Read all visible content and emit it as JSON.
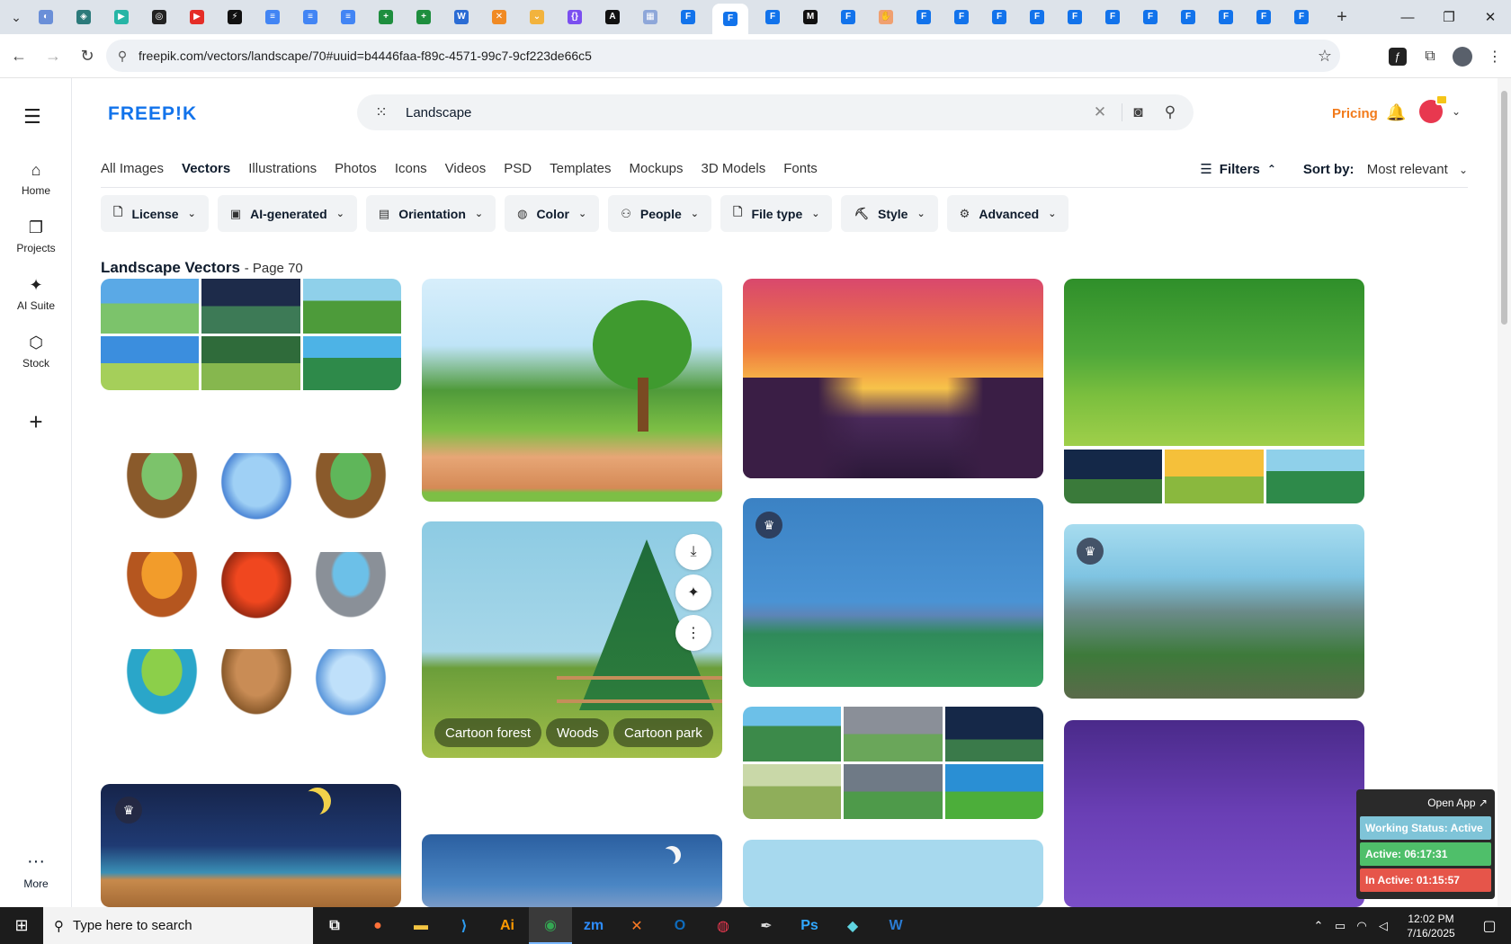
{
  "browser": {
    "tabs": [
      {
        "name": "tab-1",
        "color": "#6a8fd8",
        "glyph": "◐"
      },
      {
        "name": "tab-2",
        "color": "#2c7a7b",
        "glyph": "◈"
      },
      {
        "name": "tab-3",
        "color": "#26b5a6",
        "glyph": "▶"
      },
      {
        "name": "tab-4",
        "color": "#222222",
        "glyph": "◎"
      },
      {
        "name": "tab-youtube",
        "color": "#e52d27",
        "glyph": "▶"
      },
      {
        "name": "tab-6",
        "color": "#111111",
        "glyph": "⚡"
      },
      {
        "name": "tab-docs-1",
        "color": "#4285f4",
        "glyph": "≡"
      },
      {
        "name": "tab-docs-2",
        "color": "#4285f4",
        "glyph": "≡"
      },
      {
        "name": "tab-docs-3",
        "color": "#4285f4",
        "glyph": "≡"
      },
      {
        "name": "tab-sheets-1",
        "color": "#1e8e3e",
        "glyph": "+"
      },
      {
        "name": "tab-sheets-2",
        "color": "#1e8e3e",
        "glyph": "+"
      },
      {
        "name": "tab-12",
        "color": "#2b6cd4",
        "glyph": "W"
      },
      {
        "name": "tab-13",
        "color": "#f08a24",
        "glyph": "✕"
      },
      {
        "name": "tab-14",
        "color": "#f2b33d",
        "glyph": "⌄"
      },
      {
        "name": "tab-15",
        "color": "#7b4ff0",
        "glyph": "{}"
      },
      {
        "name": "tab-16",
        "color": "#111111",
        "glyph": "A"
      },
      {
        "name": "tab-17",
        "color": "#8ea7d9",
        "glyph": "▦"
      },
      {
        "name": "tab-freepik-1",
        "color": "#1273eb",
        "glyph": "F"
      },
      {
        "name": "tab-freepik-active",
        "color": "#1273eb",
        "glyph": "F",
        "active": true
      },
      {
        "name": "tab-freepik-3",
        "color": "#1273eb",
        "glyph": "F"
      },
      {
        "name": "tab-21",
        "color": "#111111",
        "glyph": "M"
      },
      {
        "name": "tab-freepik-4",
        "color": "#1273eb",
        "glyph": "F"
      },
      {
        "name": "tab-23",
        "color": "#f0a070",
        "glyph": "✋"
      },
      {
        "name": "tab-freepik-5",
        "color": "#1273eb",
        "glyph": "F"
      },
      {
        "name": "tab-freepik-6",
        "color": "#1273eb",
        "glyph": "F"
      },
      {
        "name": "tab-freepik-7",
        "color": "#1273eb",
        "glyph": "F"
      },
      {
        "name": "tab-freepik-8",
        "color": "#1273eb",
        "glyph": "F"
      },
      {
        "name": "tab-freepik-9",
        "color": "#1273eb",
        "glyph": "F"
      },
      {
        "name": "tab-freepik-10",
        "color": "#1273eb",
        "glyph": "F"
      },
      {
        "name": "tab-freepik-11",
        "color": "#1273eb",
        "glyph": "F"
      },
      {
        "name": "tab-freepik-12",
        "color": "#1273eb",
        "glyph": "F"
      },
      {
        "name": "tab-freepik-13",
        "color": "#1273eb",
        "glyph": "F"
      },
      {
        "name": "tab-freepik-14",
        "color": "#1273eb",
        "glyph": "F"
      },
      {
        "name": "tab-freepik-15",
        "color": "#1273eb",
        "glyph": "F"
      }
    ],
    "url": "freepik.com/vectors/landscape/70#uuid=b4446faa-f89c-4571-99c7-9cf223de66c5"
  },
  "sidebar": {
    "items": [
      {
        "label": "Home",
        "icon": "home-icon",
        "glyph": "⌂"
      },
      {
        "label": "Projects",
        "icon": "projects-icon",
        "glyph": "❐"
      },
      {
        "label": "AI Suite",
        "icon": "ai-suite-icon",
        "glyph": "✦"
      },
      {
        "label": "Stock",
        "icon": "stock-icon",
        "glyph": "⬡"
      }
    ],
    "more_label": "More"
  },
  "header": {
    "logo": "FREEP!K",
    "search_value": "Landscape",
    "pricing_label": "Pricing"
  },
  "categories": [
    "All Images",
    "Vectors",
    "Illustrations",
    "Photos",
    "Icons",
    "Videos",
    "PSD",
    "Templates",
    "Mockups",
    "3D Models",
    "Fonts"
  ],
  "active_category": "Vectors",
  "filters_label": "Filters",
  "sort": {
    "label": "Sort by:",
    "value": "Most relevant"
  },
  "filter_chips": [
    {
      "label": "License",
      "icon": "license-icon",
      "glyph": "🗋"
    },
    {
      "label": "AI-generated",
      "icon": "ai-generated-icon",
      "glyph": "▣"
    },
    {
      "label": "Orientation",
      "icon": "orientation-icon",
      "glyph": "▤"
    },
    {
      "label": "Color",
      "icon": "color-palette-icon",
      "glyph": "◍"
    },
    {
      "label": "People",
      "icon": "people-icon",
      "glyph": "⚇"
    },
    {
      "label": "File type",
      "icon": "file-type-icon",
      "glyph": "🗋"
    },
    {
      "label": "Style",
      "icon": "style-icon",
      "glyph": "⛏"
    },
    {
      "label": "Advanced",
      "icon": "advanced-settings-icon",
      "glyph": "⚙"
    }
  ],
  "page_title": {
    "main": "Landscape Vectors",
    "suffix": "- Page 70"
  },
  "tags": [
    "Cartoon forest",
    "Woods",
    "Cartoon park"
  ],
  "work_status": {
    "open_app": "Open App ↗",
    "status": "Working Status: Active",
    "active": "Active: 06:17:31",
    "inactive": "In Active: 01:15:57"
  },
  "taskbar": {
    "search_placeholder": "Type here to search",
    "apps": [
      {
        "name": "task-view",
        "glyph": "⧉",
        "color": "#ffffff"
      },
      {
        "name": "firefox",
        "glyph": "●",
        "color": "#ff7139"
      },
      {
        "name": "file-explorer",
        "glyph": "▬",
        "color": "#f4c542"
      },
      {
        "name": "vscode",
        "glyph": "⟩",
        "color": "#2e9cf0"
      },
      {
        "name": "illustrator",
        "glyph": "Ai",
        "color": "#ff9a00"
      },
      {
        "name": "chrome",
        "glyph": "◉",
        "color": "#34a853",
        "active": true
      },
      {
        "name": "zoom",
        "glyph": "zm",
        "color": "#2d8cff"
      },
      {
        "name": "xampp",
        "glyph": "✕",
        "color": "#fb7a24"
      },
      {
        "name": "outlook",
        "glyph": "O",
        "color": "#0f6cbd"
      },
      {
        "name": "creative-cloud",
        "glyph": "◍",
        "color": "#e8384f"
      },
      {
        "name": "pen-tool",
        "glyph": "✒",
        "color": "#dddddd"
      },
      {
        "name": "photoshop",
        "glyph": "Ps",
        "color": "#31a8ff"
      },
      {
        "name": "app-gem",
        "glyph": "◆",
        "color": "#5fd4e0"
      },
      {
        "name": "word",
        "glyph": "W",
        "color": "#2b7cd3"
      }
    ],
    "time": "12:02 PM",
    "date": "7/16/2025"
  }
}
